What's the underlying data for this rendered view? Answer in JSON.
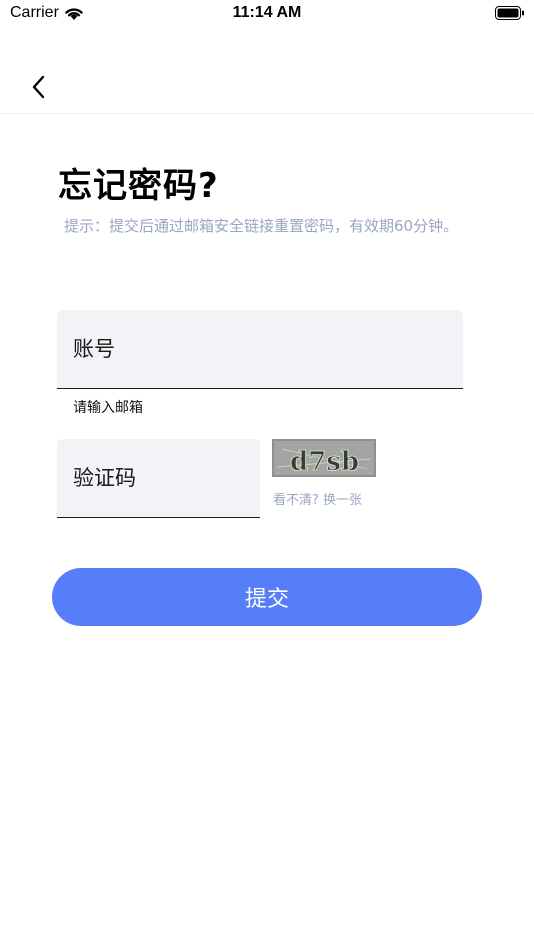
{
  "status_bar": {
    "carrier": "Carrier",
    "time": "11:14 AM"
  },
  "icons": {
    "wifi": "wifi-icon",
    "battery": "battery-icon",
    "back": "chevron-left-icon"
  },
  "page": {
    "title": "忘记密码?",
    "hint": "提示：提交后通过邮箱安全链接重置密码，有效期60分钟。"
  },
  "form": {
    "account_placeholder": "账号",
    "account_helper": "请输入邮箱",
    "captcha_placeholder": "验证码",
    "captcha_code": "d7sb",
    "captcha_refresh": "看不清? 换一张",
    "submit_label": "提交"
  },
  "colors": {
    "primary": "#557ef8",
    "field_bg": "#f2f2f7",
    "hint_text": "#9aa6c0"
  }
}
